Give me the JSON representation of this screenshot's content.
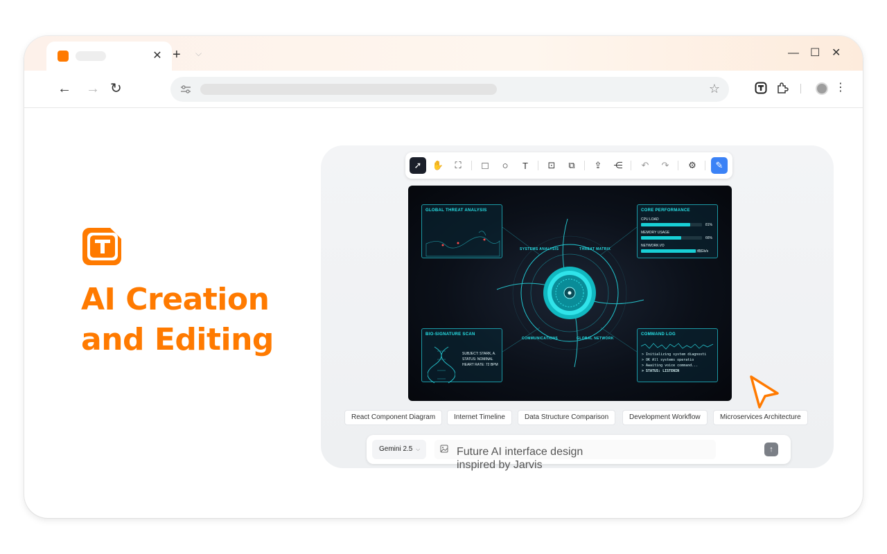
{
  "browser": {
    "tab": {
      "close_glyph": "✕",
      "favicon_color": "#ff7a00"
    },
    "new_tab_glyph": "+",
    "tab_menu_glyph": "⌵",
    "window_controls": {
      "minimize": "—",
      "maximize": "☐",
      "close": "✕"
    },
    "nav": {
      "back": "←",
      "forward": "→",
      "reload": "↻"
    },
    "star_glyph": "☆",
    "menu_glyph": "⋮"
  },
  "hero": {
    "line1": "AI Creation",
    "line2": "and Editing",
    "accent_color": "#ff7a00",
    "logo_letter": "T"
  },
  "drawing_toolbar": {
    "tools": [
      {
        "name": "select-tool",
        "glyph": "➚",
        "active": true
      },
      {
        "name": "hand-tool",
        "glyph": "✋"
      },
      {
        "name": "frame-tool",
        "glyph": "⛶"
      },
      {
        "name": "rectangle-tool",
        "glyph": "□"
      },
      {
        "name": "ellipse-tool",
        "glyph": "○"
      },
      {
        "name": "text-tool",
        "glyph": "T"
      },
      {
        "name": "scan-tool",
        "glyph": "⊡"
      },
      {
        "name": "connector-tool",
        "glyph": "⧉"
      },
      {
        "name": "export-tool",
        "glyph": "⇪"
      },
      {
        "name": "share-tool",
        "glyph": "⋲"
      },
      {
        "name": "undo-tool",
        "glyph": "↶"
      },
      {
        "name": "redo-tool",
        "glyph": "↷"
      },
      {
        "name": "settings-tool",
        "glyph": "⚙"
      },
      {
        "name": "ai-edit-tool",
        "glyph": "✎",
        "highlight": true
      }
    ]
  },
  "canvas": {
    "threat": {
      "title": "GLOBAL THREAT ANALYSIS"
    },
    "perf": {
      "title": "CORE PERFORMANCE",
      "cpu_label": "CPU LOAD",
      "cpu_value": "81%",
      "cpu_level": 0.81,
      "mem_label": "MEMORY USAGE",
      "mem_value": "66%",
      "mem_level": 0.66,
      "net_label": "NETWORK I/O",
      "net_value": "45Gb/s",
      "net_level": 0.9
    },
    "bio": {
      "title": "BIO-SIGNATURE SCAN",
      "subject": "SUBJECT: STARK, A.",
      "status": "STATUS: NOMINAL",
      "heart": "HEART RATE: 72 BPM"
    },
    "log": {
      "title": "COMMAND LOG",
      "line1": "> Initializing system diagnosti",
      "line2": "> OK All systems operatio",
      "line3": "> Awaiting voice command...",
      "line4": "> STATUS: LISTENIN"
    },
    "labels": {
      "systems": "SYSTEMS ANALYSIS",
      "threat_matrix": "THREAT MATRIX",
      "communications": "COMMUNICATIONS",
      "global_network": "GLOBAL NETWORK"
    }
  },
  "suggestions": [
    "React Component Diagram",
    "Internet Timeline",
    "Data Structure Comparison",
    "Development Workflow",
    "Microservices Architecture"
  ],
  "prompt": {
    "model": "Gemini 2.5",
    "model_caret": "⌵",
    "value": "Future AI interface design inspired by Jarvis",
    "send_glyph": "↑"
  }
}
